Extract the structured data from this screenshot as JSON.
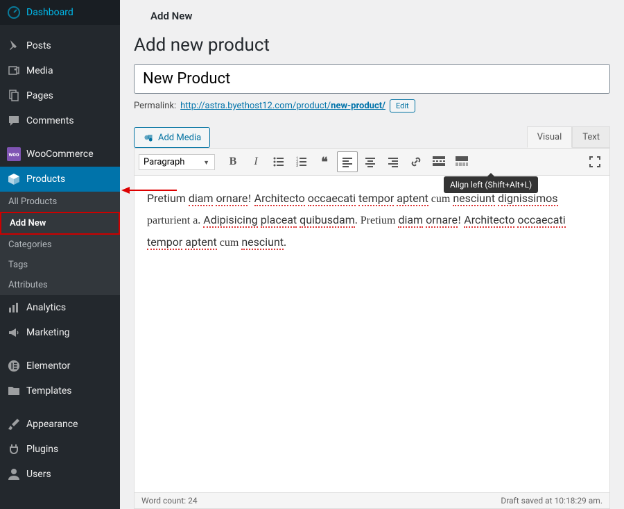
{
  "sidebar": {
    "items": [
      {
        "label": "Dashboard"
      },
      {
        "label": "Posts"
      },
      {
        "label": "Media"
      },
      {
        "label": "Pages"
      },
      {
        "label": "Comments"
      },
      {
        "label": "WooCommerce"
      },
      {
        "label": "Products"
      },
      {
        "label": "Analytics"
      },
      {
        "label": "Marketing"
      },
      {
        "label": "Elementor"
      },
      {
        "label": "Templates"
      },
      {
        "label": "Appearance"
      },
      {
        "label": "Plugins"
      },
      {
        "label": "Users"
      }
    ],
    "submenu": [
      {
        "label": "All Products"
      },
      {
        "label": "Add New"
      },
      {
        "label": "Categories"
      },
      {
        "label": "Tags"
      },
      {
        "label": "Attributes"
      }
    ]
  },
  "breadcrumb": "Add New",
  "page_title": "Add new product",
  "title_value": "New Product",
  "permalink": {
    "label": "Permalink:",
    "base": "http://astra.byethost12.com/product/",
    "slug": "new-product/",
    "edit": "Edit"
  },
  "add_media": "Add Media",
  "tabs": {
    "visual": "Visual",
    "text": "Text"
  },
  "format": "Paragraph",
  "tooltip": "Align left (Shift+Alt+L)",
  "content": {
    "w1": "Pretium",
    "w2": "diam",
    "w3": "ornare",
    "w4": "Architecto",
    "w5": "occaecati",
    "w6": "tempor",
    "w7": "aptent",
    "w8": "nesciunt",
    "w9": "dignissimos",
    "w10": "Adipisicing",
    "w11": "placeat",
    "w12": "quibusdam",
    "w13": "diam",
    "w14": "ornare",
    "w15": "Architecto",
    "w16": "occaecati",
    "w17": "tempor",
    "w18": "aptent",
    "w19": "nesciunt"
  },
  "status": {
    "wordcount": "Word count: 24",
    "saved": "Draft saved at 10:18:29 am."
  }
}
